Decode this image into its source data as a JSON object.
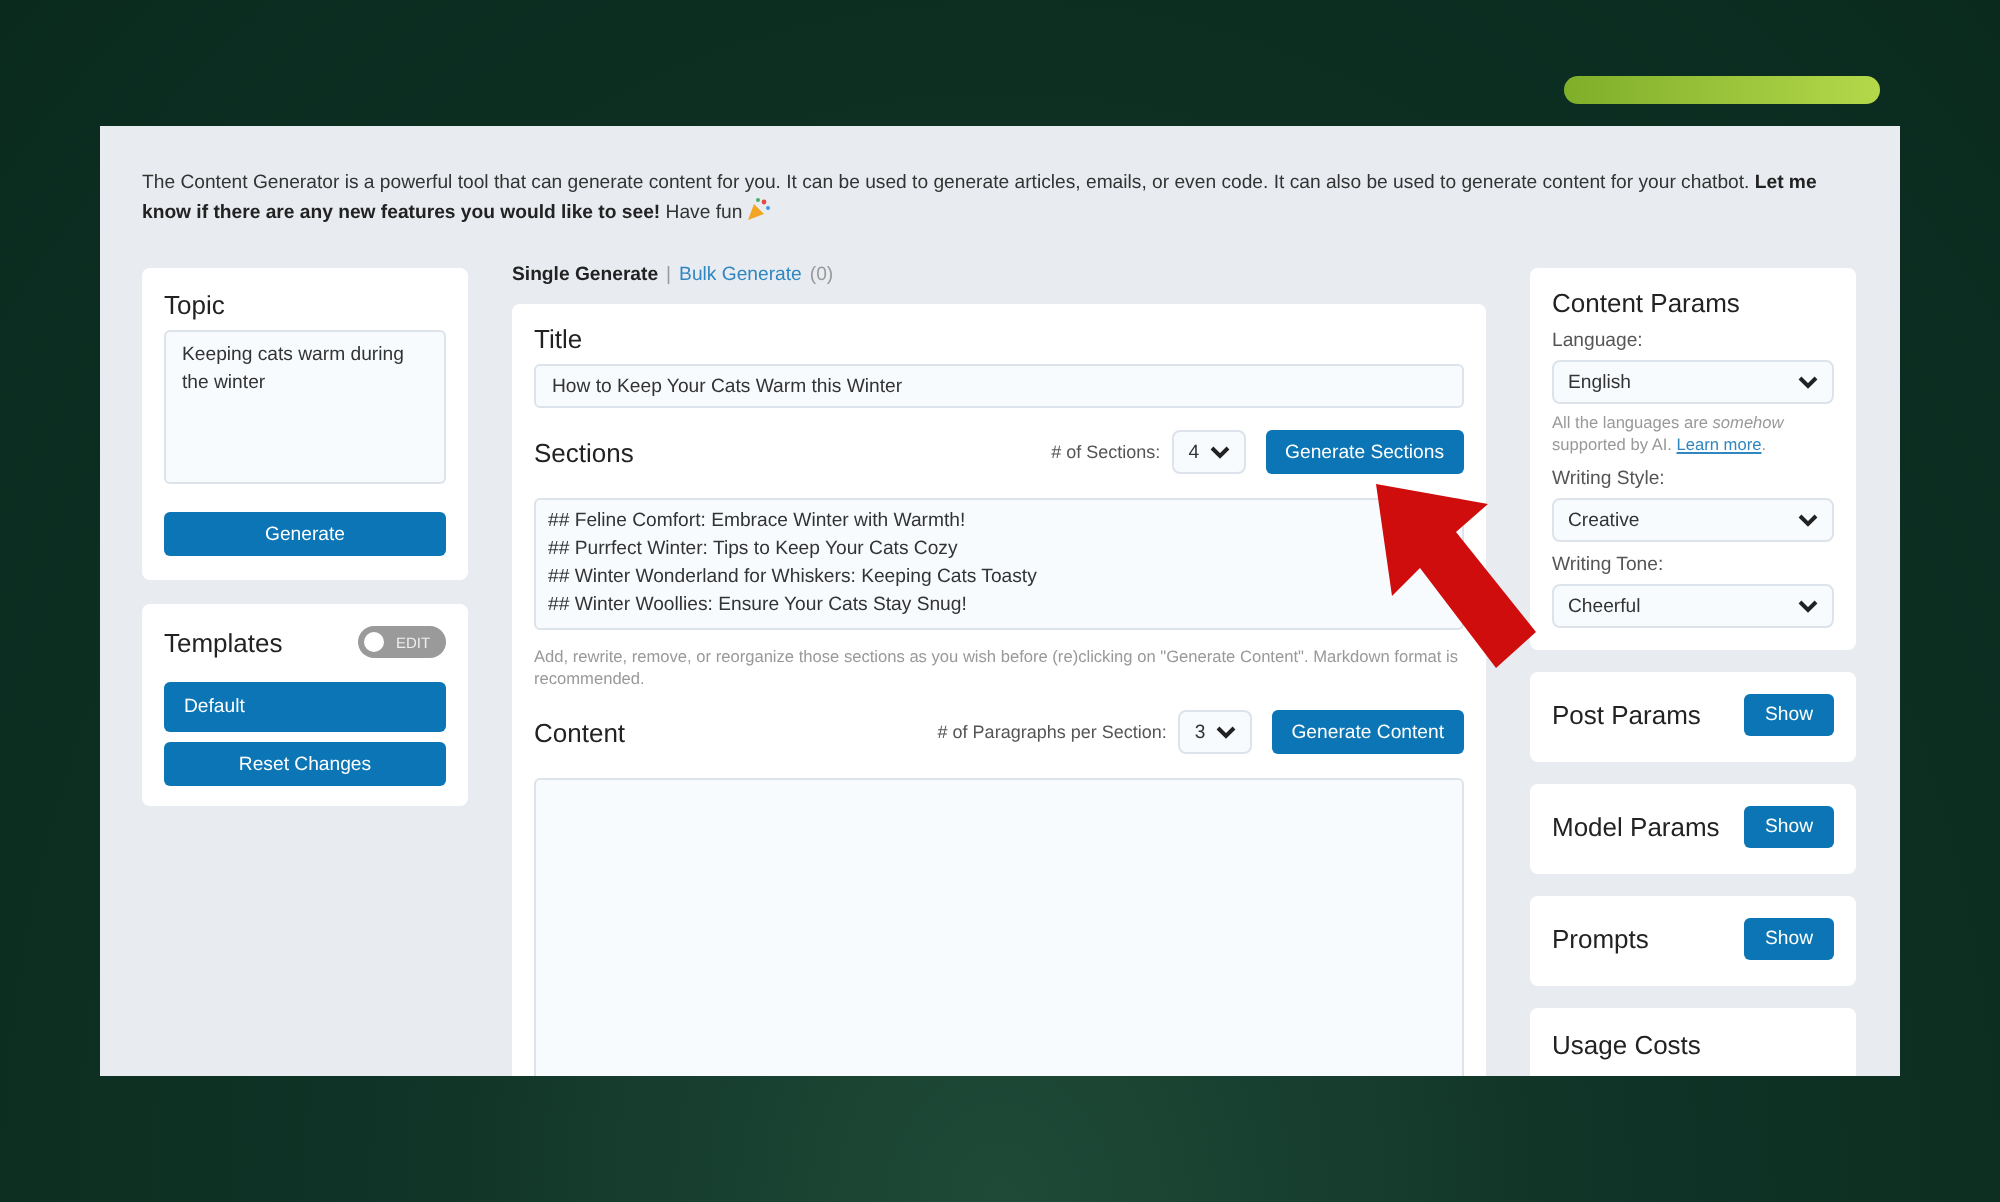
{
  "intro": "The Content Generator is a powerful tool that can generate content for you. It can be used to generate articles, emails, or even code. It can also be used to generate content for your chatbot. **Let me know if there are any new features you would like to see!** Have fun",
  "topic": {
    "title": "Topic",
    "value": "Keeping cats warm during the winter",
    "button": "Generate"
  },
  "templates": {
    "title": "Templates",
    "toggle": {
      "label": "EDIT",
      "on": false
    },
    "items": [
      {
        "label": "Default",
        "kind": "template"
      },
      {
        "label": "Reset Changes",
        "kind": "action"
      }
    ]
  },
  "tabs": [
    {
      "label": "Single Generate",
      "selected": true
    },
    {
      "label": "Bulk Generate",
      "count": "(0)",
      "selected": false
    }
  ],
  "tab_separator": "|",
  "title_section": {
    "title": "Title",
    "value": "How to Keep Your Cats Warm this Winter"
  },
  "sections": {
    "title": "Sections",
    "count_label": "# of Sections:",
    "count": "4",
    "button": "Generate Sections",
    "lines": [
      "## Feline Comfort: Embrace Winter with Warmth!",
      "## Purrfect Winter: Tips to Keep Your Cats Cozy",
      "## Winter Wonderland for Whiskers: Keeping Cats Toasty",
      "## Winter Woollies: Ensure Your Cats Stay Snug!"
    ],
    "hint": "Add, rewrite, remove, or reorganize those sections as you wish before (re)clicking on \"Generate Content\". Markdown format is recommended."
  },
  "content": {
    "title": "Content",
    "count_label": "# of Paragraphs per Section:",
    "count": "3",
    "button": "Generate Content"
  },
  "content_params": {
    "title": "Content Params",
    "language_label": "Language:",
    "language": "English",
    "language_note": "All the languages are *somehow* supported by AI.",
    "learn_more": "Learn more",
    "period": ".",
    "style_label": "Writing Style:",
    "style": "Creative",
    "tone_label": "Writing Tone:",
    "tone": "Cheerful"
  },
  "panels": [
    {
      "title": "Post Params",
      "button": "Show"
    },
    {
      "title": "Model Params",
      "button": "Show"
    },
    {
      "title": "Prompts",
      "button": "Show"
    },
    {
      "title": "Usage Costs"
    }
  ]
}
